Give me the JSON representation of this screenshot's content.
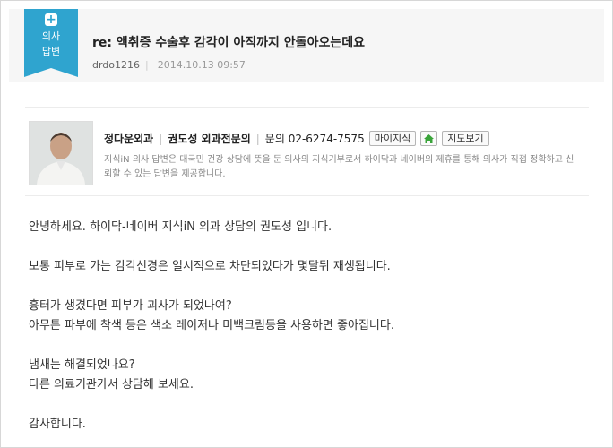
{
  "badge": {
    "line1": "의사",
    "line2": "답변"
  },
  "title": "re: 액취증 수술후 감각이 아직까지 안돌아오는데요",
  "meta": {
    "user": "drdo1216",
    "date": "2014.10.13 09:57"
  },
  "doctor": {
    "clinic": "정다운외과",
    "name": "권도성 외과전문의",
    "phone_label": "문의 02-6274-7575",
    "btn_knowledge": "마이지식",
    "btn_map": "지도보기",
    "note": "지식iN 의사 답변은 대국민 건강 상담에 뜻을 둔 의사의 지식기부로서 하이닥과 네이버의 제휴를 통해 의사가 직접 정확하고 신뢰할 수 있는 답변을 제공합니다."
  },
  "answer": {
    "p1": "안녕하세요. 하이닥-네이버 지식iN 외과 상담의 권도성 입니다.",
    "p2": "보통 피부로 가는 감각신경은 일시적으로 차단되었다가 몇달뒤 재생됩니다.",
    "p3a": "흉터가 생겼다면 피부가 괴사가 되었나여?",
    "p3b": "아무튼 파부에 착색  등은 색소 레이저나 미백크림등을 사용하면 좋아집니다.",
    "p4a": "냄새는 해결되었나요?",
    "p4b": "다른 의료기관가서 상담해 보세요.",
    "p5": "감사합니다."
  },
  "colors": {
    "badge": "#2fa4cf",
    "home": "#3aa43a"
  },
  "icons": {
    "badge": "plus-icon",
    "home": "home-icon"
  }
}
